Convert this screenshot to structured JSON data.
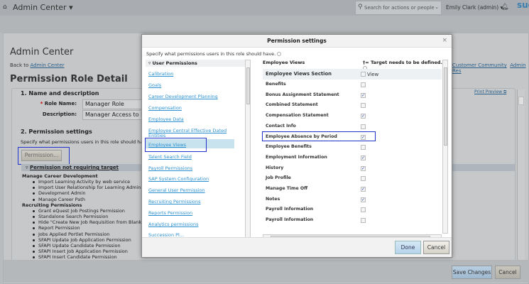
{
  "header": {
    "app_title": "Admin Center ▾",
    "search_placeholder": "Search for actions or people",
    "user": "Emily Clark (admin) ▾",
    "brand": "suc"
  },
  "page": {
    "title": "Admin Center",
    "back_prefix": "Back to",
    "back_link": "Admin Center",
    "top_links": [
      "Customer Community",
      "Admin Res"
    ],
    "heading": "Permission Role Detail",
    "print_preview": "Print Preview"
  },
  "section1": {
    "title": "1. Name and description",
    "role_name_label": "Role Name:",
    "role_name_value": "Manager Role",
    "description_label": "Description:",
    "description_value": "Manager Access to Employee"
  },
  "section2": {
    "title": "2. Permission settings",
    "desc": "Specify what permissions users in this role should have.",
    "permission_button": "Permission...",
    "bar_label": "Permission not requiring target",
    "groups": [
      {
        "name": "Manage Career Development",
        "items": [
          "Import Learning Activity by web service",
          "Import User Relationship for Learning Administrators",
          "Development Admin",
          "Manage Career Path"
        ]
      },
      {
        "name": "Recruiting Permissions",
        "items": [
          "Grant eQuest Job Postings Permission",
          "Standalone Search Permission",
          "Hide \"Create New Job Requisition from Blank Template\"",
          "Report Permission",
          "Jobs Applied Portlet Permission",
          "SFAPI Update Job Application Permission",
          "SFAPI Update Candidate Permission",
          "SFAPI Insert Job Application Permission",
          "SFAPI Insert Candidate Permission"
        ]
      }
    ]
  },
  "footer": {
    "save": "Save Changes",
    "cancel": "Cancel"
  },
  "modal": {
    "title": "Permission settings",
    "close": "×",
    "desc": "Specify what permissions users in this role should have.",
    "left_header": "User Permissions",
    "left_items": [
      "Calibration",
      "Goals",
      "Career Development Planning",
      "Compensation",
      "Employee Data",
      "Employee Central Effective Dated Entities",
      "Employee Views",
      "Talent Search Field",
      "Payroll Permissions",
      "SAP System Configuration",
      "General User Permission",
      "Recruiting Permissions",
      "Reports Permission",
      "Analytics permissions",
      "Succession Pl..."
    ],
    "selected_left": "Employee Views",
    "right_header": "Employee Views",
    "right_note": "†= Target needs to be defined.",
    "section_row": "Employee Views Section",
    "view_label": "View",
    "rows": [
      {
        "label": "Benefits",
        "checked": false
      },
      {
        "label": "Bonus Assignment Statement",
        "checked": true
      },
      {
        "label": "Combined Statement",
        "checked": false
      },
      {
        "label": "Compensation Statement",
        "checked": true
      },
      {
        "label": "Contact Info",
        "checked": false
      },
      {
        "label": "Employee Absence by Period",
        "checked": true
      },
      {
        "label": "Employee Benefits",
        "checked": false
      },
      {
        "label": "Employment Information",
        "checked": true
      },
      {
        "label": "History",
        "checked": true
      },
      {
        "label": "Job Profile",
        "checked": false
      },
      {
        "label": "Manage Time Off",
        "checked": true
      },
      {
        "label": "Notes",
        "checked": true
      },
      {
        "label": "Payroll Information",
        "checked": false
      },
      {
        "label": "Payroll Information",
        "checked": false
      }
    ],
    "done": "Done",
    "cancel": "Cancel"
  }
}
